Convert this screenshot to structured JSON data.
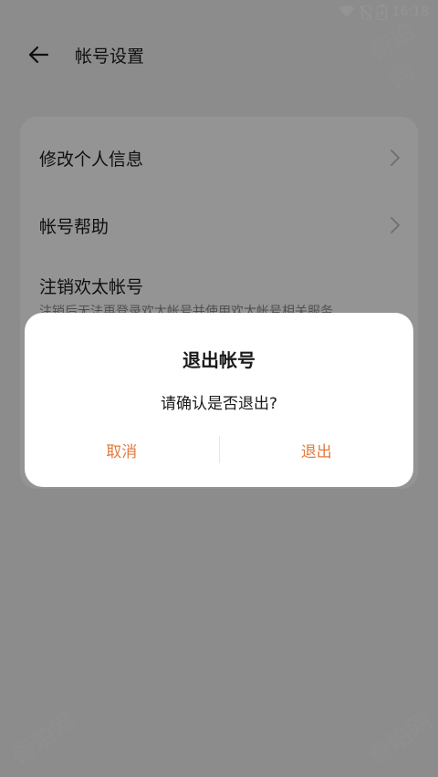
{
  "status": {
    "time": "16:18"
  },
  "header": {
    "title": "帐号设置"
  },
  "settings": {
    "items": [
      {
        "label": "修改个人信息"
      },
      {
        "label": "帐号帮助"
      },
      {
        "label": "注销欢太帐号",
        "sub": "注销后无法再登录欢太帐号并使用欢太帐号相关服务"
      }
    ]
  },
  "dialog": {
    "title": "退出帐号",
    "message": "请确认是否退出?",
    "cancel_label": "取消",
    "confirm_label": "退出"
  },
  "watermark": "奇珀网",
  "colors": {
    "accent": "#e37a3c"
  }
}
